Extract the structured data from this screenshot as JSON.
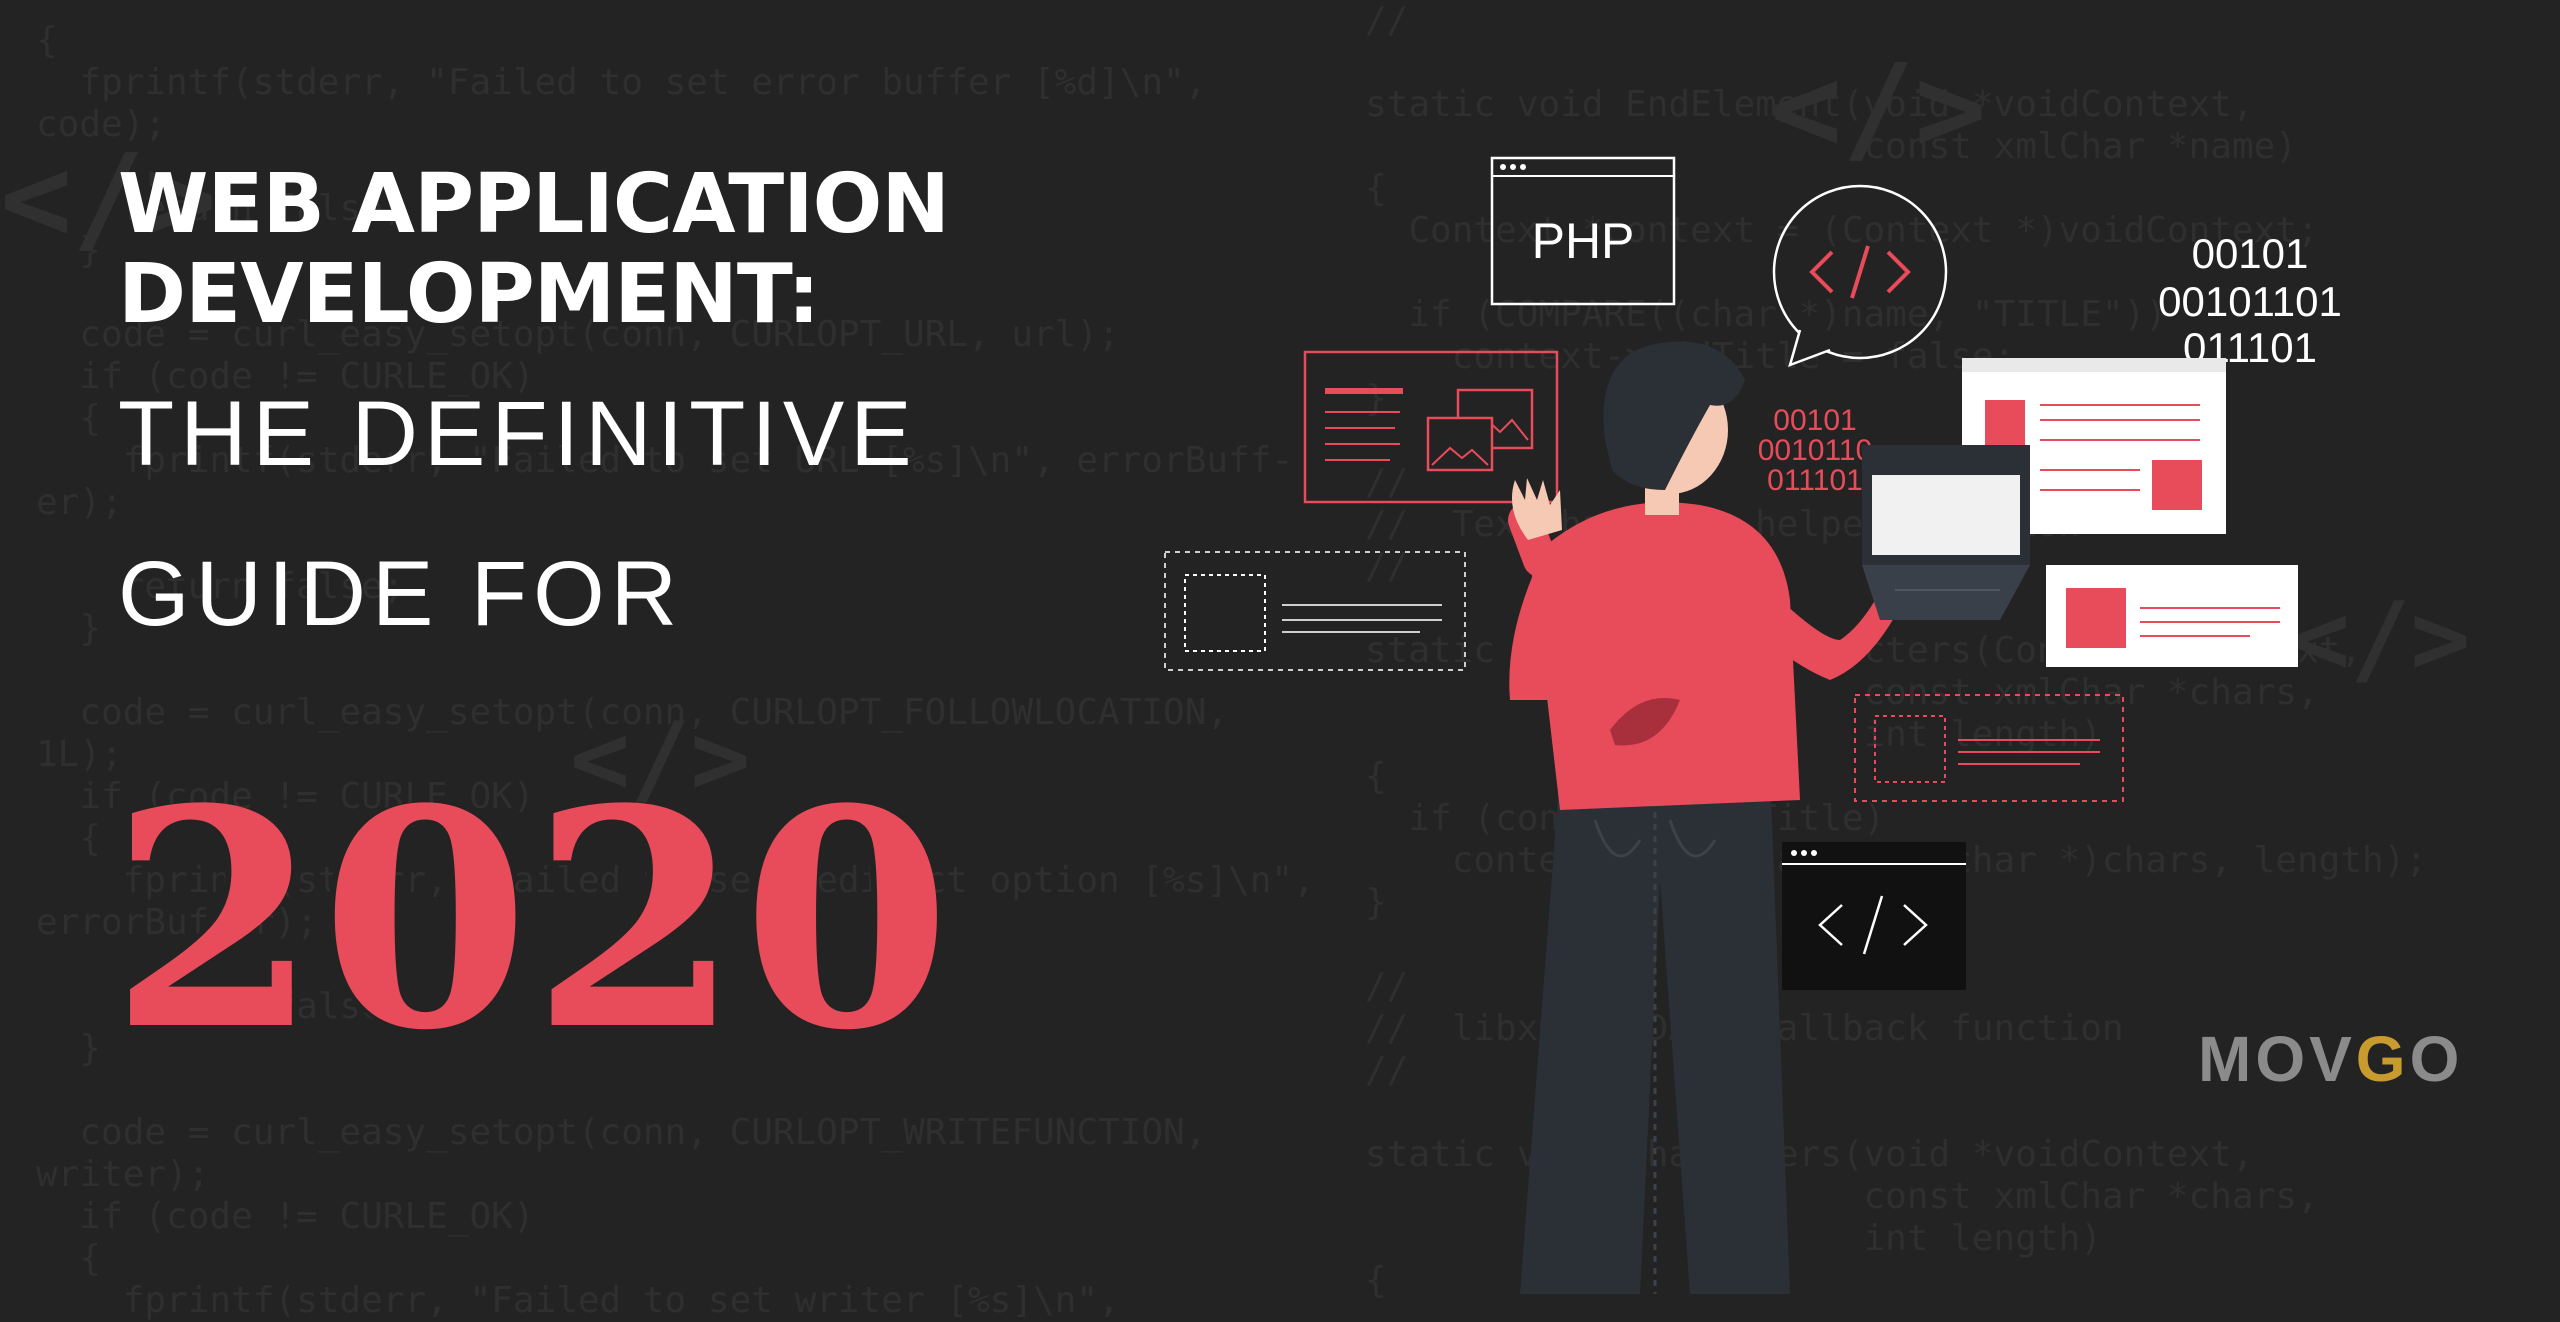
{
  "headline": {
    "line1": "WEB APPLICATION",
    "line2": "DEVELOPMENT:",
    "line3": "THE DEFINITIVE",
    "line4": "GUIDE FOR",
    "year": "2020"
  },
  "illustration": {
    "php_label": "PHP",
    "binary_white": [
      "00101",
      "00101101",
      "011101"
    ],
    "binary_red": [
      "00101",
      "0010110",
      "011101"
    ]
  },
  "logo": {
    "text": "MOVGO",
    "part1": "MO",
    "part2": "V",
    "part3": "G",
    "part4": "O"
  },
  "background_code": {
    "left": [
      "{",
      "  fprintf(stderr, \"Failed to set error buffer [%d]\\n\",",
      "code);",
      "",
      "    return false;",
      "  }",
      "",
      "  code = curl_easy_setopt(conn, CURLOPT_URL, url);",
      "  if (code != CURLE_OK)",
      "  {",
      "    fprintf(stderr, \"Failed to set URL [%s]\\n\", errorBuff-",
      "er);",
      "",
      "    return false;",
      "  }",
      "",
      "  code = curl_easy_setopt(conn, CURLOPT_FOLLOWLOCATION,",
      "1L);",
      "  if (code != CURLE_OK)",
      "  {",
      "    fprintf(stderr, \"Failed to set redirect option [%s]\\n\",",
      "errorBuffer);",
      "",
      "    return false;",
      "  }",
      "",
      "  code = curl_easy_setopt(conn, CURLOPT_WRITEFUNCTION,",
      "writer);",
      "  if (code != CURLE_OK)",
      "  {",
      "    fprintf(stderr, \"Failed to set writer [%s]\\n\","
    ],
    "right": [
      "//",
      "",
      "static void EndElement(void *voidContext,",
      "                       const xmlChar *name)",
      "{",
      "  Context *context = (Context *)voidContext;",
      "",
      "  if (COMPARE((char *)name, \"TITLE\"))",
      "    context->addTitle = false;",
      "}",
      "",
      "//",
      "//  Text handling helper function",
      "//",
      "",
      "static void handleCharacters(Context *context,",
      "                       const xmlChar *chars,",
      "                       int length)",
      "{",
      "  if (context->addTitle)",
      "    context->title.append((char *)chars, length);",
      "}",
      "",
      "//",
      "//  libxml PCDATA callback function",
      "//",
      "",
      "static void Characters(void *voidContext,",
      "                       const xmlChar *chars,",
      "                       int length)",
      "{"
    ]
  },
  "colors": {
    "background": "#232323",
    "accent_red": "#e84b5a",
    "white": "#ffffff",
    "code_grey": "#2f2f2f",
    "logo_grey": "#8b8b8b",
    "logo_gold": "#c99b2f"
  }
}
